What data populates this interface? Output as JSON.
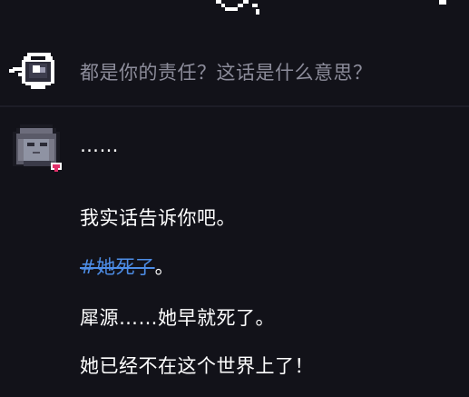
{
  "colors": {
    "background": "#121219",
    "player_text": "#8c8c9a",
    "npc_text": "#ffffff",
    "tag_link": "#4d8de6",
    "avatar_accent": "#e0306a"
  },
  "dialogue": {
    "player": {
      "avatar_icon": "shadow-cat-icon",
      "text": "都是你的责任？这话是什么意思？"
    },
    "npc": {
      "avatar_icon": "gray-haired-portrait-icon",
      "lines": [
        {
          "text": "……"
        },
        {
          "text": "我实话告诉你吧。"
        },
        {
          "link": "#她死了",
          "suffix": "。"
        },
        {
          "text": "犀源……她早就死了。"
        },
        {
          "text": "她已经不在这个世界上了！"
        }
      ]
    }
  }
}
